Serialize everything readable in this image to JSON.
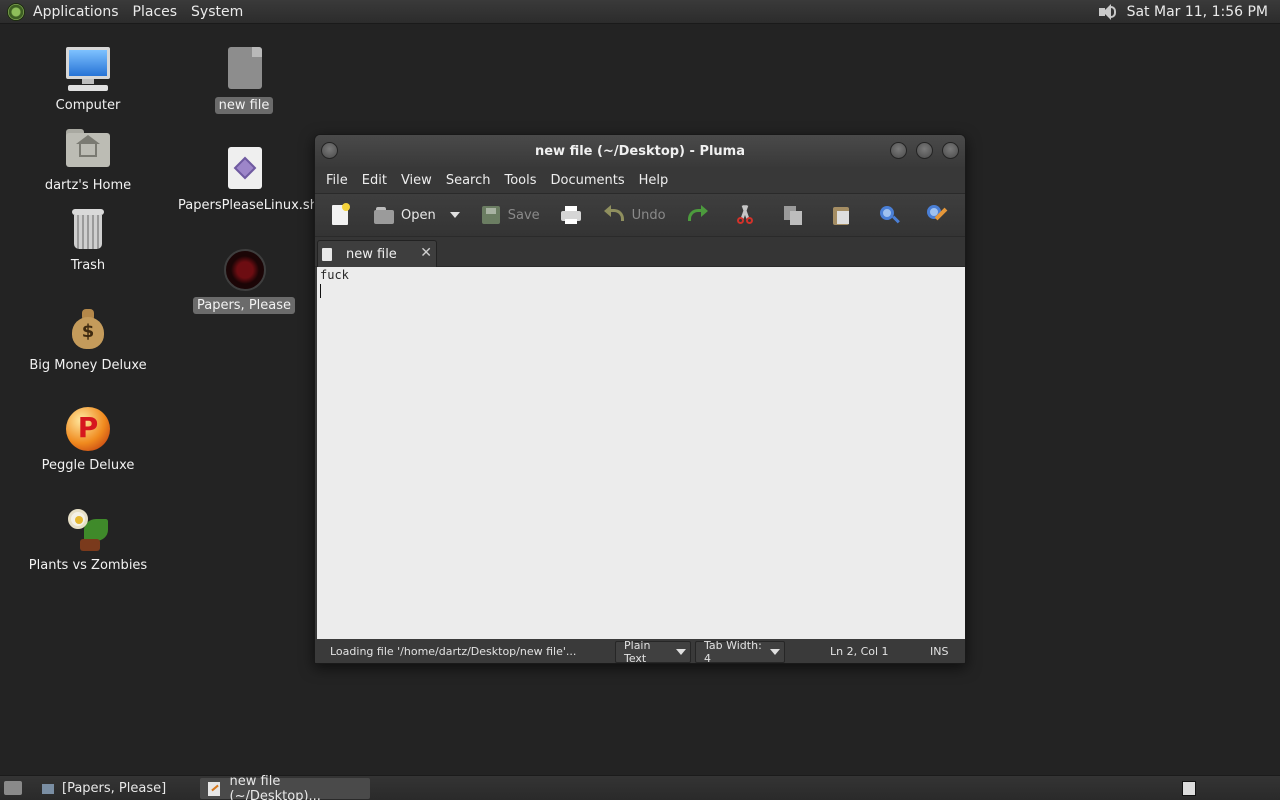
{
  "top_panel": {
    "menus": [
      "Applications",
      "Places",
      "System"
    ],
    "clock": "Sat Mar 11,  1:56 PM",
    "volume_icon": "speaker-icon"
  },
  "desktop": {
    "icons_left": [
      {
        "label": "Computer",
        "icon": "computer-icon"
      },
      {
        "label": "dartz's Home",
        "icon": "home-folder-icon"
      },
      {
        "label": "Trash",
        "icon": "trash-icon"
      },
      {
        "label": "Big Money Deluxe",
        "icon": "money-bag-icon"
      },
      {
        "label": "Peggle Deluxe",
        "icon": "peggle-icon"
      },
      {
        "label": "Plants vs Zombies",
        "icon": "plants-vs-zombies-icon"
      }
    ],
    "icons_right": [
      {
        "label": "new file",
        "icon": "file-icon",
        "selected": true
      },
      {
        "label": "PapersPleaseLinux.sh",
        "icon": "script-file-icon",
        "selected": false
      },
      {
        "label": "Papers, Please",
        "icon": "papers-please-icon",
        "selected": true
      }
    ]
  },
  "window": {
    "title": "new file (~/Desktop) - Pluma",
    "menu": [
      "File",
      "Edit",
      "View",
      "Search",
      "Tools",
      "Documents",
      "Help"
    ],
    "toolbar": {
      "open_label": "Open",
      "save_label": "Save",
      "undo_label": "Undo"
    },
    "tab": {
      "name": "new file",
      "close": "✕"
    },
    "editor": {
      "lines": [
        "fuck",
        ""
      ]
    },
    "status": {
      "message": "Loading file '/home/dartz/Desktop/new file'...",
      "language": "Plain Text",
      "tab_width": "Tab Width:  4",
      "position": "Ln 2, Col 1",
      "mode": "INS"
    }
  },
  "taskbar": {
    "items": [
      {
        "label": "[Papers, Please]",
        "active": false
      },
      {
        "label": "new file (~/Desktop)...",
        "active": true
      }
    ]
  }
}
